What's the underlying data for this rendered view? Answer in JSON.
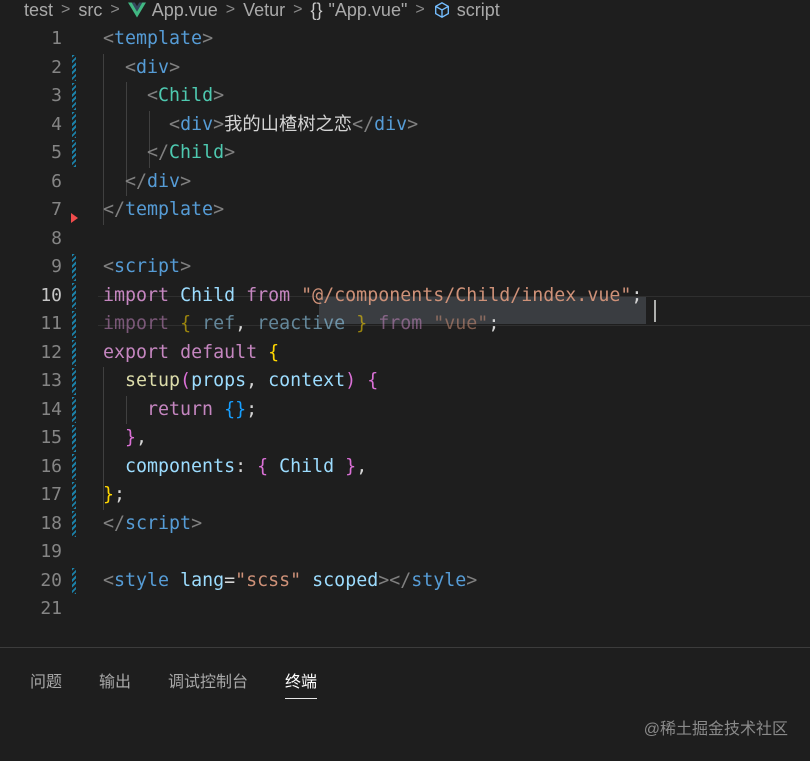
{
  "breadcrumb": {
    "items": [
      "test",
      "src",
      "App.vue",
      "Vetur",
      "\"App.vue\"",
      "script"
    ],
    "braces": "{}",
    "icons": [
      "vue-logo-icon",
      "braces-icon",
      "cube-icon"
    ]
  },
  "editor": {
    "active_line": 10,
    "lines": [
      {
        "n": "1",
        "tokens": [
          [
            "b",
            "<"
          ],
          [
            "t",
            "template"
          ],
          [
            "b",
            ">"
          ]
        ]
      },
      {
        "n": "2",
        "tokens": [
          [
            "s",
            "  "
          ],
          [
            "b",
            "<"
          ],
          [
            "t",
            "div"
          ],
          [
            "b",
            ">"
          ]
        ]
      },
      {
        "n": "3",
        "tokens": [
          [
            "s",
            "    "
          ],
          [
            "b",
            "<"
          ],
          [
            "c",
            "Child"
          ],
          [
            "b",
            ">"
          ]
        ]
      },
      {
        "n": "4",
        "tokens": [
          [
            "s",
            "      "
          ],
          [
            "b",
            "<"
          ],
          [
            "t",
            "div"
          ],
          [
            "b",
            ">"
          ],
          [
            "x",
            "我的山楂树之恋"
          ],
          [
            "b",
            "</"
          ],
          [
            "t",
            "div"
          ],
          [
            "b",
            ">"
          ]
        ]
      },
      {
        "n": "5",
        "tokens": [
          [
            "s",
            "    "
          ],
          [
            "b",
            "</"
          ],
          [
            "c",
            "Child"
          ],
          [
            "b",
            ">"
          ]
        ]
      },
      {
        "n": "6",
        "tokens": [
          [
            "s",
            "  "
          ],
          [
            "b",
            "</"
          ],
          [
            "t",
            "div"
          ],
          [
            "b",
            ">"
          ]
        ]
      },
      {
        "n": "7",
        "tokens": [
          [
            "b",
            "</"
          ],
          [
            "t",
            "template"
          ],
          [
            "b",
            ">"
          ]
        ]
      },
      {
        "n": "8",
        "tokens": []
      },
      {
        "n": "9",
        "tokens": [
          [
            "b",
            "<"
          ],
          [
            "t",
            "script"
          ],
          [
            "b",
            ">"
          ]
        ]
      },
      {
        "n": "10",
        "tokens": [
          [
            "k",
            "import"
          ],
          [
            "x",
            " "
          ],
          [
            "v",
            "Child"
          ],
          [
            "x",
            " "
          ],
          [
            "k",
            "from"
          ],
          [
            "x",
            " "
          ],
          [
            "r",
            "\"@/components/Child/index.vue\""
          ],
          [
            "x",
            ";"
          ]
        ]
      },
      {
        "n": "11",
        "tokens": [
          [
            "kd",
            "import"
          ],
          [
            "x",
            " "
          ],
          [
            "yd",
            "{"
          ],
          [
            "vd",
            " ref"
          ],
          [
            "x",
            ", "
          ],
          [
            "vd",
            "reactive"
          ],
          [
            "x",
            " "
          ],
          [
            "yd",
            "}"
          ],
          [
            "x",
            " "
          ],
          [
            "kd",
            "from"
          ],
          [
            "x",
            " "
          ],
          [
            "rd",
            "\"vue\""
          ],
          [
            "x",
            ";"
          ]
        ]
      },
      {
        "n": "12",
        "tokens": [
          [
            "k",
            "export"
          ],
          [
            "x",
            " "
          ],
          [
            "k",
            "default"
          ],
          [
            "x",
            " "
          ],
          [
            "y",
            "{"
          ]
        ]
      },
      {
        "n": "13",
        "tokens": [
          [
            "s",
            "  "
          ],
          [
            "f",
            "setup"
          ],
          [
            "p",
            "("
          ],
          [
            "v",
            "props"
          ],
          [
            "x",
            ", "
          ],
          [
            "v",
            "context"
          ],
          [
            "p",
            ")"
          ],
          [
            "x",
            " "
          ],
          [
            "p",
            "{"
          ]
        ]
      },
      {
        "n": "14",
        "tokens": [
          [
            "s",
            "    "
          ],
          [
            "k",
            "return"
          ],
          [
            "x",
            " "
          ],
          [
            "u",
            "{}"
          ],
          [
            "x",
            ";"
          ]
        ]
      },
      {
        "n": "15",
        "tokens": [
          [
            "s",
            "  "
          ],
          [
            "p",
            "}"
          ],
          [
            "x",
            ","
          ]
        ]
      },
      {
        "n": "16",
        "tokens": [
          [
            "s",
            "  "
          ],
          [
            "v",
            "components"
          ],
          [
            "x",
            ": "
          ],
          [
            "p",
            "{"
          ],
          [
            "x",
            " "
          ],
          [
            "v",
            "Child"
          ],
          [
            "x",
            " "
          ],
          [
            "p",
            "}"
          ],
          [
            "x",
            ","
          ]
        ]
      },
      {
        "n": "17",
        "tokens": [
          [
            "y",
            "}"
          ],
          [
            "x",
            ";"
          ]
        ]
      },
      {
        "n": "18",
        "tokens": [
          [
            "b",
            "</"
          ],
          [
            "t",
            "script"
          ],
          [
            "b",
            ">"
          ]
        ]
      },
      {
        "n": "19",
        "tokens": []
      },
      {
        "n": "20",
        "tokens": [
          [
            "b",
            "<"
          ],
          [
            "t",
            "style"
          ],
          [
            "x",
            " "
          ],
          [
            "a",
            "lang"
          ],
          [
            "x",
            "="
          ],
          [
            "r",
            "\"scss\""
          ],
          [
            "x",
            " "
          ],
          [
            "a",
            "scoped"
          ],
          [
            "b",
            "></"
          ],
          [
            "t",
            "style"
          ],
          [
            "b",
            ">"
          ]
        ]
      },
      {
        "n": "21",
        "tokens": []
      }
    ],
    "modified_lines": [
      "2",
      "3",
      "4",
      "5",
      "9",
      "10",
      "11",
      "12",
      "13",
      "14",
      "15",
      "16",
      "17",
      "18",
      "20"
    ]
  },
  "panel": {
    "tabs": [
      "问题",
      "输出",
      "调试控制台",
      "终端"
    ],
    "active_tab": "终端"
  },
  "watermark": "@稀土掘金技术社区",
  "colors": {
    "background": "#1e1e1e",
    "tag": "#569cd6",
    "component": "#4ec9b0",
    "keyword": "#c586c0",
    "variable": "#9cdcfe",
    "string": "#ce9178",
    "function": "#dcdcaa",
    "bracket_gold": "#ffd700",
    "bracket_pink": "#da70d6",
    "bracket_blue": "#179fff",
    "modified_bar": "#1b81a8"
  }
}
